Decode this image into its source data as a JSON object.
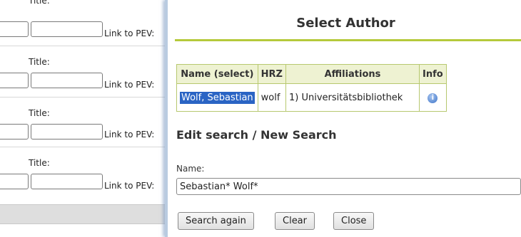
{
  "background_form": {
    "rows": [
      {
        "title_label": "Title:",
        "link_label": "Link to PEV:"
      },
      {
        "title_label": "Title:",
        "link_label": "Link to PEV:"
      },
      {
        "title_label": "Title:",
        "link_label": "Link to PEV:"
      },
      {
        "title_label": "Title:",
        "link_label": "Link to PEV:"
      }
    ]
  },
  "dialog": {
    "title": "Select Author",
    "table": {
      "headers": [
        "Name (select)",
        "HRZ",
        "Affiliations",
        "Info"
      ],
      "rows": [
        {
          "name": "Wolf, Sebastian",
          "hrz": "wolf",
          "affiliation": "1) Universitätsbibliothek",
          "info_icon": "info-icon"
        }
      ]
    },
    "section_title": "Edit search / New Search",
    "name_label": "Name:",
    "name_value": "Sebastian* Wolf*",
    "buttons": {
      "search_again": "Search again",
      "clear": "Clear",
      "close": "Close"
    }
  },
  "colors": {
    "accent_rule": "#b5c93b",
    "header_bg": "#eef2d2",
    "selection": "#2a64c4"
  }
}
